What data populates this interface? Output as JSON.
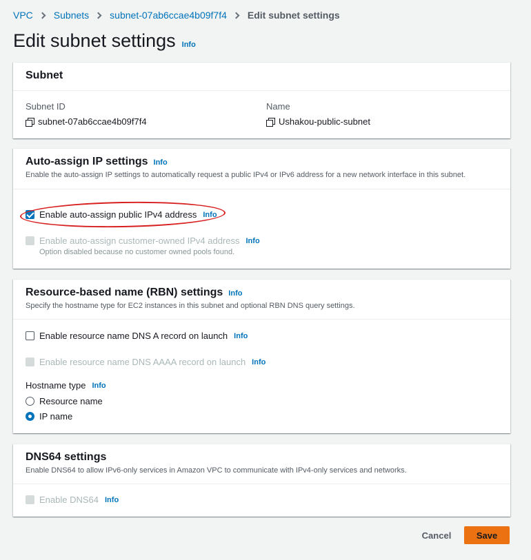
{
  "breadcrumb": {
    "items": [
      "VPC",
      "Subnets",
      "subnet-07ab6ccae4b09f7f4"
    ],
    "current": "Edit subnet settings"
  },
  "page": {
    "title": "Edit subnet settings",
    "info": "Info"
  },
  "subnet_section": {
    "title": "Subnet",
    "subnet_id_label": "Subnet ID",
    "subnet_id_value": "subnet-07ab6ccae4b09f7f4",
    "name_label": "Name",
    "name_value": "Ushakou-public-subnet"
  },
  "auto_assign": {
    "title": "Auto-assign IP settings",
    "info": "Info",
    "description": "Enable the auto-assign IP settings to automatically request a public IPv4 or IPv6 address for a new network interface in this subnet.",
    "ipv4": {
      "label": "Enable auto-assign public IPv4 address",
      "checked": true,
      "info": "Info"
    },
    "customer_owned": {
      "label": "Enable auto-assign customer-owned IPv4 address",
      "disabled": true,
      "info": "Info",
      "hint": "Option disabled because no customer owned pools found."
    }
  },
  "rbn": {
    "title": "Resource-based name (RBN) settings",
    "info": "Info",
    "description": "Specify the hostname type for EC2 instances in this subnet and optional RBN DNS query settings.",
    "dns_a": {
      "label": "Enable resource name DNS A record on launch",
      "checked": false,
      "info": "Info"
    },
    "dns_aaaa": {
      "label": "Enable resource name DNS AAAA record on launch",
      "disabled": true,
      "info": "Info"
    },
    "hostname_type": {
      "label": "Hostname type",
      "info": "Info",
      "options": [
        "Resource name",
        "IP name"
      ],
      "selected": "IP name"
    }
  },
  "dns64": {
    "title": "DNS64 settings",
    "description": "Enable DNS64 to allow IPv6-only services in Amazon VPC to communicate with IPv4-only services and networks.",
    "enable": {
      "label": "Enable DNS64",
      "disabled": true,
      "info": "Info"
    }
  },
  "actions": {
    "cancel": "Cancel",
    "save": "Save"
  },
  "colors": {
    "link": "#0073bb",
    "primary_button": "#ec7211",
    "annotation": "#d81f1f"
  },
  "icons": {
    "copy": "copy-icon",
    "breadcrumb_separator": "chevron-right-icon"
  }
}
